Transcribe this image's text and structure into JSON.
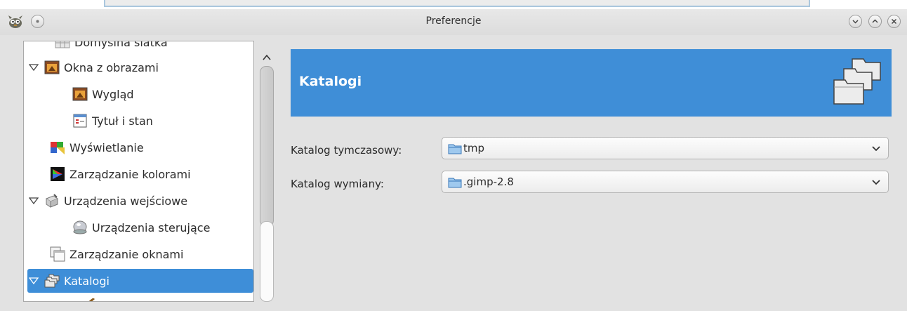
{
  "window": {
    "title": "Preferencje"
  },
  "sidebar": {
    "partial_top_label": "Domyślna siatka",
    "items": [
      {
        "label": "Okna z obrazami",
        "icon": "image-window-icon"
      },
      {
        "label": "Wygląd",
        "icon": "appearance-icon"
      },
      {
        "label": "Tytuł i stan",
        "icon": "title-status-icon"
      },
      {
        "label": "Wyświetlanie",
        "icon": "display-icon"
      },
      {
        "label": "Zarządzanie kolorami",
        "icon": "color-management-icon"
      },
      {
        "label": "Urządzenia wejściowe",
        "icon": "input-devices-icon"
      },
      {
        "label": "Urządzenia sterujące",
        "icon": "input-controllers-icon"
      },
      {
        "label": "Zarządzanie oknami",
        "icon": "window-management-icon"
      },
      {
        "label": "Katalogi",
        "icon": "folders-icon",
        "selected": true
      }
    ]
  },
  "header": {
    "title": "Katalogi",
    "icon": "folders-icon"
  },
  "form": {
    "temp_label": "Katalog tymczasowy:",
    "temp_value": "tmp",
    "swap_label": "Katalog wymiany:",
    "swap_value": ".gimp-2.8"
  },
  "colors": {
    "accent": "#3e8ed8",
    "header_bg": "#3f8ed7",
    "window_bg": "#e2e2e2"
  }
}
